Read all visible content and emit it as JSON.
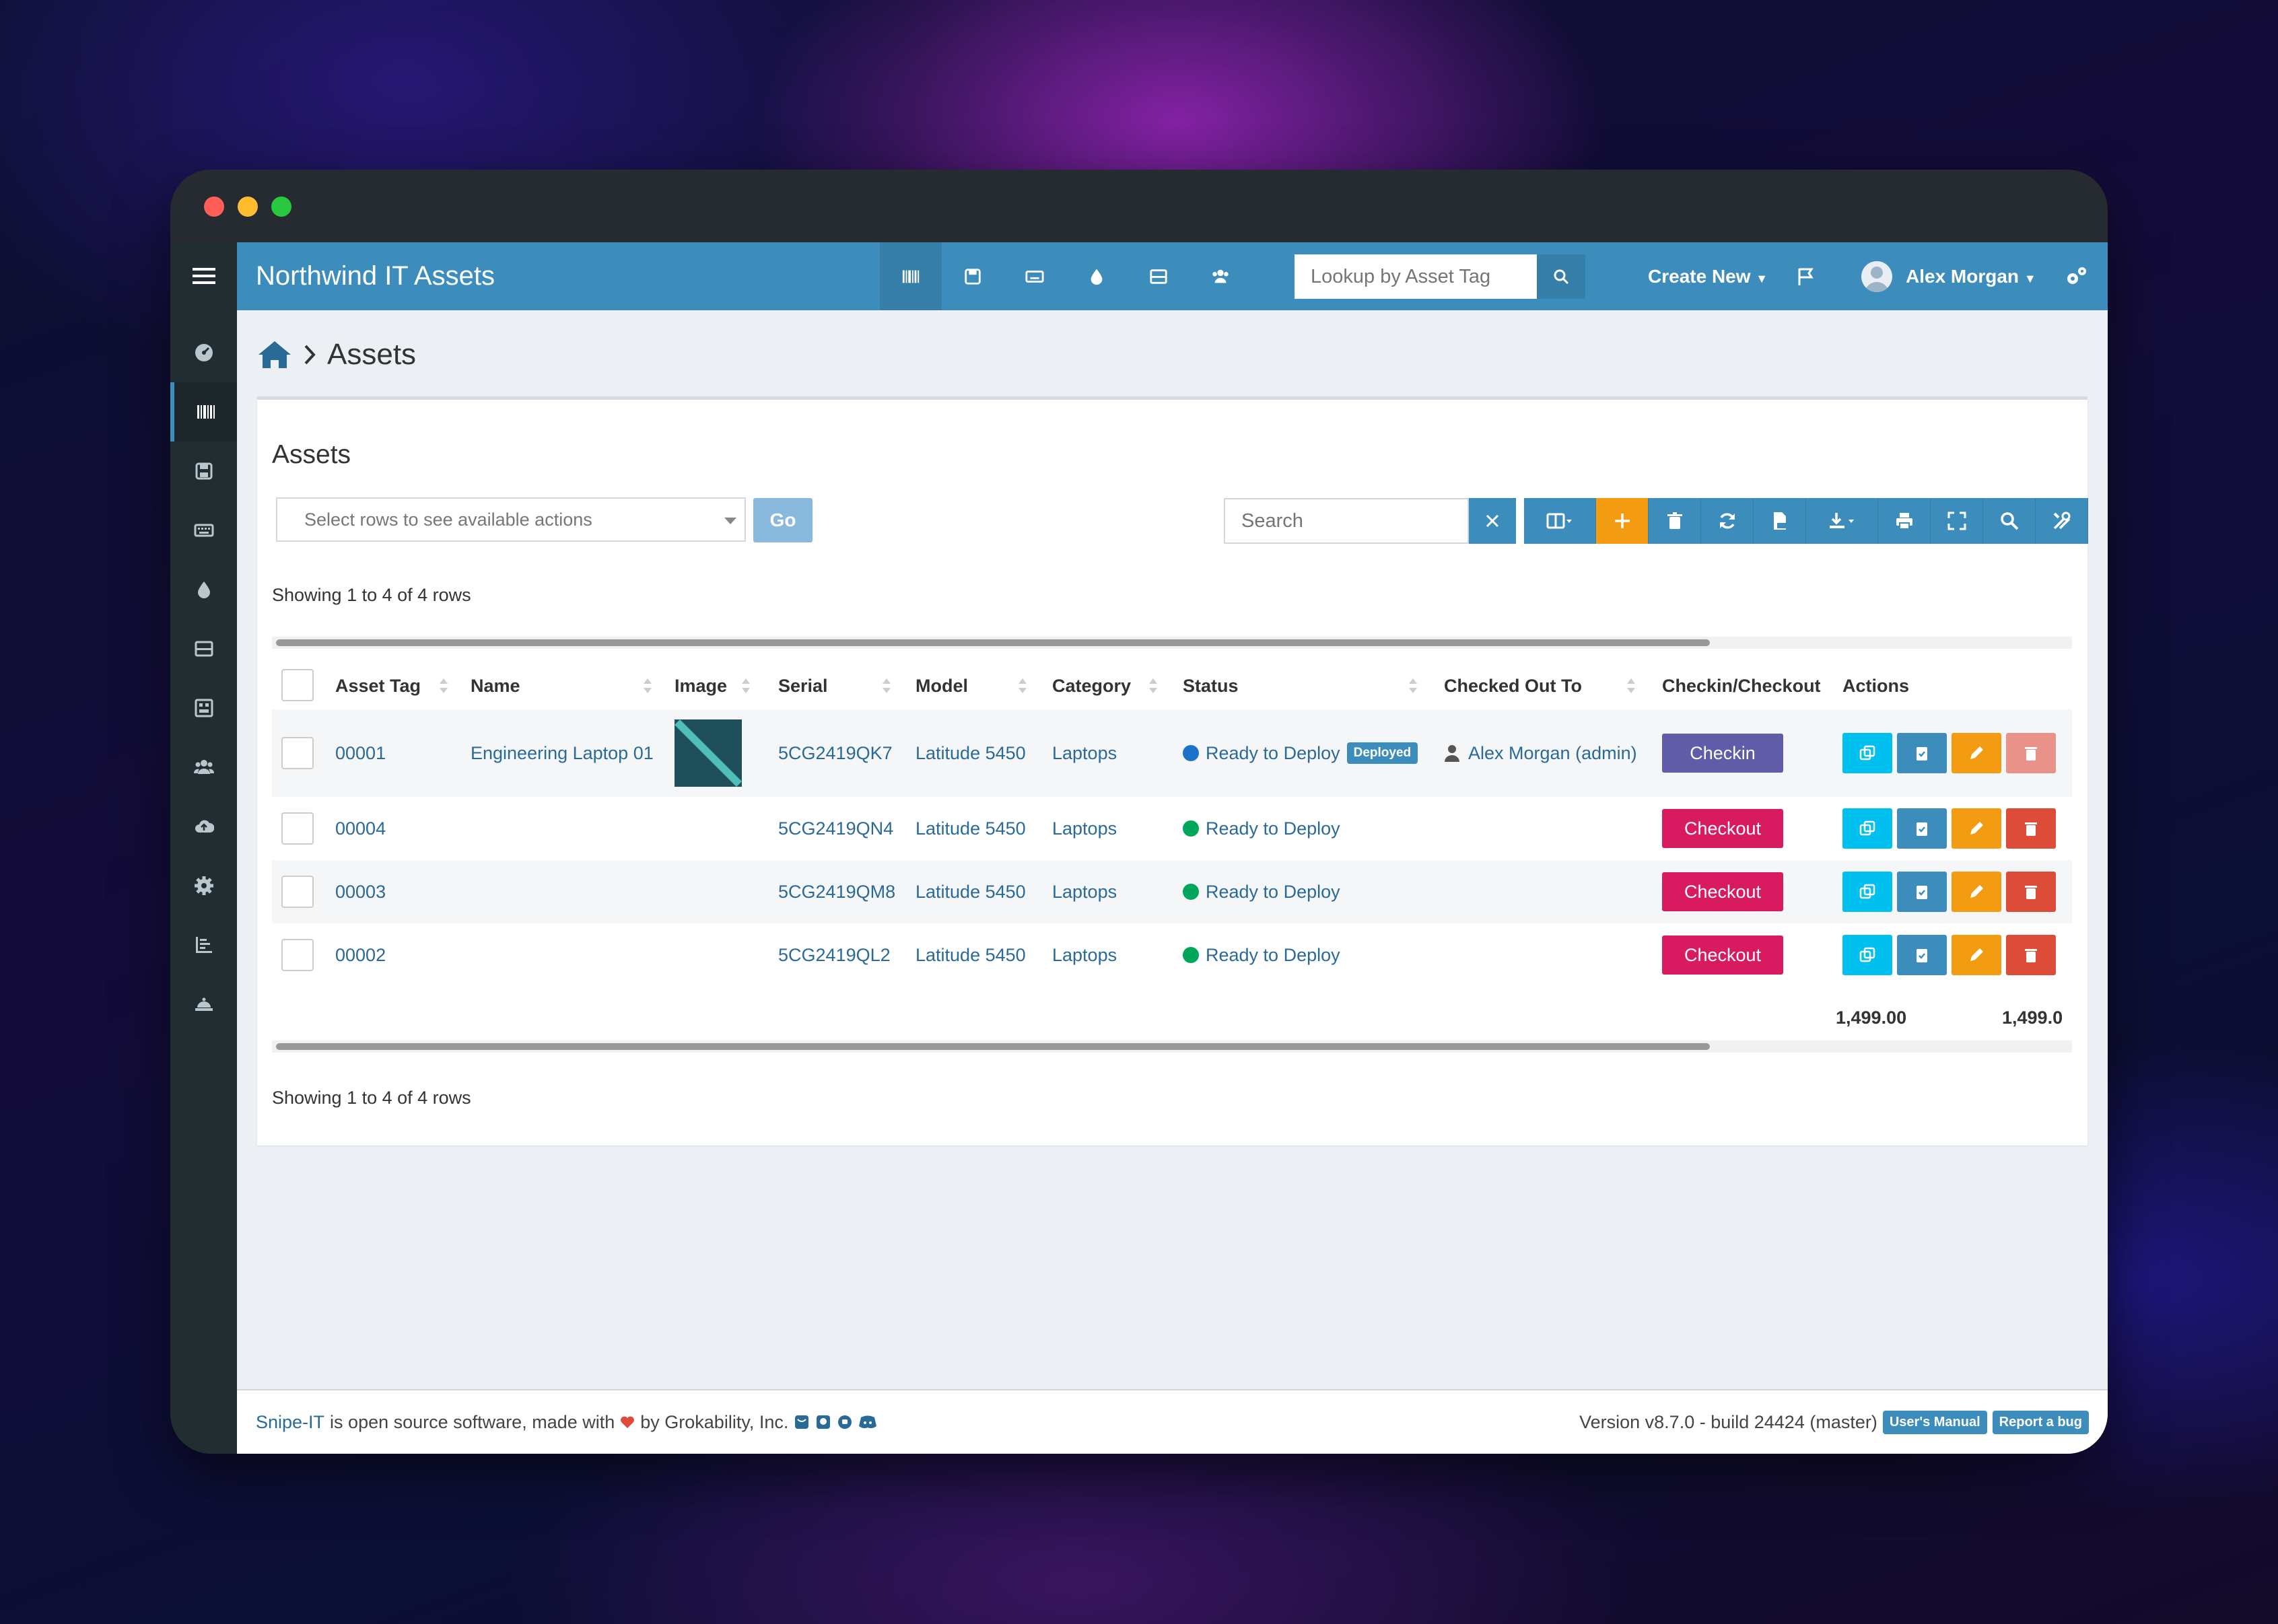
{
  "app": {
    "title": "Northwind IT Assets"
  },
  "topbar": {
    "lookup_placeholder": "Lookup by Asset Tag",
    "create_new": "Create New",
    "user_name": "Alex Morgan",
    "icons": [
      "barcode-icon",
      "save-icon",
      "keyboard-icon",
      "tint-icon",
      "hdd-icon",
      "users-icon"
    ]
  },
  "sidebar": {
    "items": [
      "dashboard-icon",
      "barcode-icon",
      "save-icon",
      "keyboard-icon",
      "tint-icon",
      "hdd-icon",
      "building-icon",
      "users-icon",
      "cloud-upload-icon",
      "settings-icon",
      "reports-icon",
      "bell-icon"
    ]
  },
  "breadcrumb": {
    "current": "Assets"
  },
  "panel": {
    "title": "Assets",
    "bulk_placeholder": "Select rows to see available actions",
    "go_label": "Go",
    "search_placeholder": "Search",
    "showing_top": "Showing 1 to 4 of 4 rows",
    "showing_bottom": "Showing 1 to 4 of 4 rows"
  },
  "table": {
    "columns": [
      "Asset Tag",
      "Name",
      "Image",
      "Serial",
      "Model",
      "Category",
      "Status",
      "Checked Out To",
      "Checkin/Checkout",
      "Actions"
    ],
    "rows": [
      {
        "tag": "00001",
        "name": "Engineering Laptop 01",
        "serial": "5CG2419QK7",
        "model": "Latitude 5450",
        "category": "Laptops",
        "status": "Ready to Deploy",
        "badge": "Deployed",
        "checked_out_to": "Alex Morgan (admin)",
        "button": "Checkin"
      },
      {
        "tag": "00004",
        "name": "",
        "serial": "5CG2419QN4",
        "model": "Latitude 5450",
        "category": "Laptops",
        "status": "Ready to Deploy",
        "badge": "",
        "checked_out_to": "",
        "button": "Checkout"
      },
      {
        "tag": "00003",
        "name": "",
        "serial": "5CG2419QM8",
        "model": "Latitude 5450",
        "category": "Laptops",
        "status": "Ready to Deploy",
        "badge": "",
        "checked_out_to": "",
        "button": "Checkout"
      },
      {
        "tag": "00002",
        "name": "",
        "serial": "5CG2419QL2",
        "model": "Latitude 5450",
        "category": "Laptops",
        "status": "Ready to Deploy",
        "badge": "",
        "checked_out_to": "",
        "button": "Checkout"
      }
    ],
    "totals": [
      "1,499.00",
      "1,499.0"
    ]
  },
  "footer": {
    "brand": "Snipe-IT",
    "text_a": "is open source software, made with",
    "text_b": "by Grokability, Inc.",
    "version": "Version v8.7.0 - build 24424 (master)",
    "manual": "User's Manual",
    "bug": "Report a bug"
  },
  "colors": {
    "primary": "#3c8dbc",
    "sidebar": "#222d32",
    "checkin": "#605ca8",
    "checkout": "#d81b60",
    "warning": "#f39c12",
    "danger": "#dd4b39",
    "info": "#00c0ef",
    "status_deployed": "#1a73c9",
    "status_ready": "#00a65a"
  }
}
